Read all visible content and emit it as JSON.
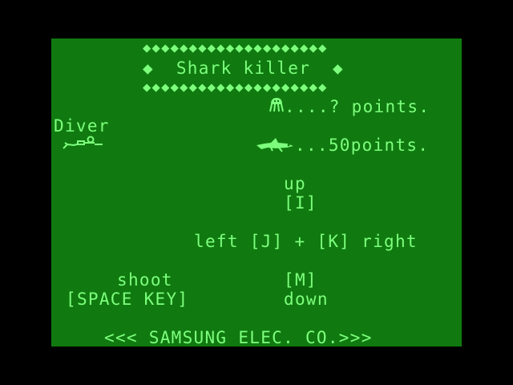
{
  "colors": {
    "border": "#000000",
    "screen": "#107a10",
    "text": "#7dff7d"
  },
  "title": {
    "top_border": "◆◆◆◆◆◆◆◆◆◆◆◆◆◆◆◆◆◆◆◆",
    "line": "◆  Shark killer  ◆",
    "bottom_border": "◆◆◆◆◆◆◆◆◆◆◆◆◆◆◆◆◆◆◆◆"
  },
  "scores": {
    "jellyfish": {
      "icon": "jellyfish-icon",
      "text": "....? points."
    },
    "shark": {
      "icon": "shark-icon",
      "text": "...50points."
    }
  },
  "diver": {
    "label": "Diver",
    "icon": "diver-icon"
  },
  "controls": {
    "up_label": "up",
    "up_key": "[I]",
    "left_right": "left [J] + [K] right",
    "shoot_label": "shoot",
    "shoot_key": "[SPACE KEY]",
    "down_key": "[M]",
    "down_label": "down"
  },
  "footer": "<<< SAMSUNG ELEC. CO.>>>"
}
